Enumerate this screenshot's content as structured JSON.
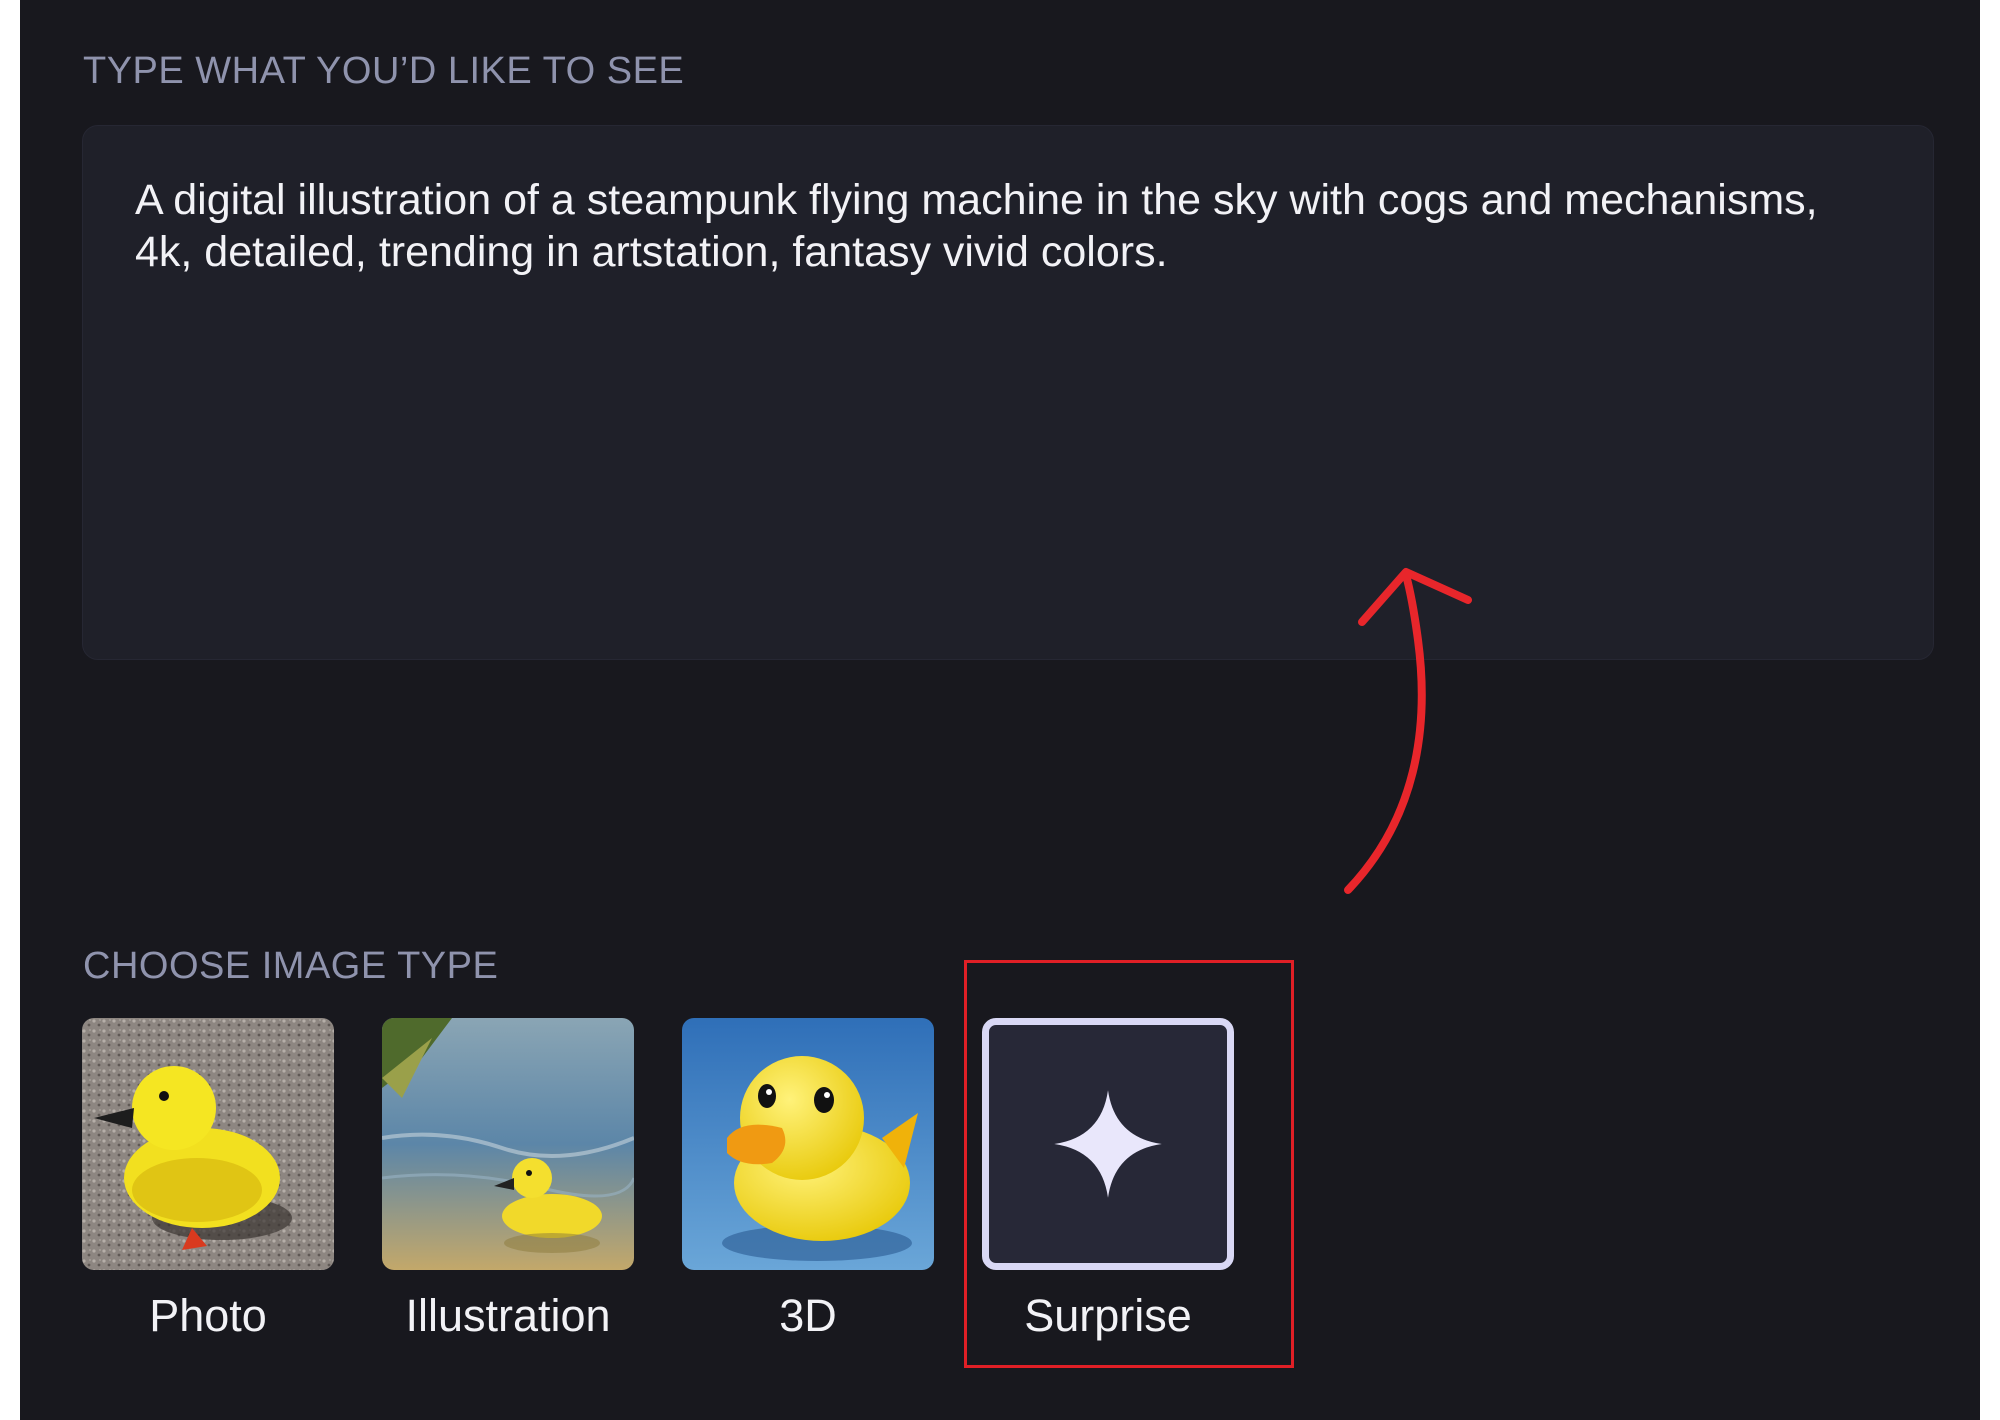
{
  "prompt_section": {
    "label": "TYPE WHAT YOU’D LIKE TO SEE",
    "text": "A digital illustration of a steampunk flying machine in the sky with cogs and mechanisms, 4k, detailed, trending in artstation, fantasy vivid colors."
  },
  "image_type_section": {
    "label": "CHOOSE IMAGE TYPE",
    "options": [
      {
        "label": "Photo",
        "icon": "photo-rubber-duck-thumbnail"
      },
      {
        "label": "Illustration",
        "icon": "illustration-rubber-duck-thumbnail"
      },
      {
        "label": "3D",
        "icon": "3d-rubber-duck-thumbnail"
      },
      {
        "label": "Surprise",
        "icon": "sparkle-icon"
      }
    ]
  },
  "annotation": {
    "highlight_color": "#e01f26",
    "arrow_color": "#e8262b"
  },
  "colors": {
    "background": "#18181e",
    "input_background": "#1f2029",
    "label_color": "#8f93ad",
    "text_color": "#f2f2f6"
  }
}
